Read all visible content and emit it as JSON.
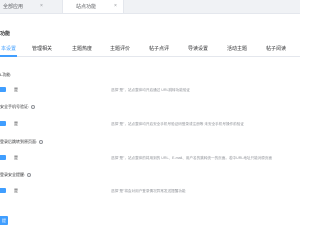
{
  "topbar": {
    "tabs": [
      {
        "label": "全部应用"
      },
      {
        "label": "站点功能"
      }
    ],
    "close_glyph": "×"
  },
  "section": {
    "title": "功能"
  },
  "settings_tabs": [
    {
      "label": "本设置",
      "active": true
    },
    {
      "label": "管理相关",
      "active": false
    },
    {
      "label": "主题热度",
      "active": false
    },
    {
      "label": "主题评价",
      "active": false
    },
    {
      "label": "帖子点评",
      "active": false
    },
    {
      "label": "导读设置",
      "active": false
    },
    {
      "label": "活动主题",
      "active": false
    },
    {
      "label": "帖子阅读",
      "active": false
    }
  ],
  "fields": [
    {
      "label": "L功能:",
      "toggle_label": "是",
      "hint": "选择\"是\"，站点整体均开启通过 URL跳转功能验证",
      "has_help_icon": false
    },
    {
      "label": "安全手机号验证:",
      "toggle_label": "是",
      "hint": "选择\"是\"，站点整体均开启安全手机号验证码登录或注册等 未安全手机号操作前验证",
      "has_help_icon": true
    },
    {
      "label": "登录后跳转到原页面:",
      "toggle_label": "是",
      "hint": "选择\"是\"，站点整体的将用到的 URL、E-mail、用户名的跳转统一的页面。若中URL地址只能对原页面",
      "has_help_icon": true
    },
    {
      "label": "登录安全提醒:",
      "toggle_label": "是",
      "hint": "选择\"是\"将会对用户登录情况异常发送提醒功能",
      "has_help_icon": true
    }
  ],
  "save_button": {
    "label": "提"
  },
  "colors": {
    "accent": "#409eff",
    "hint": "#909399",
    "text": "#303133"
  }
}
